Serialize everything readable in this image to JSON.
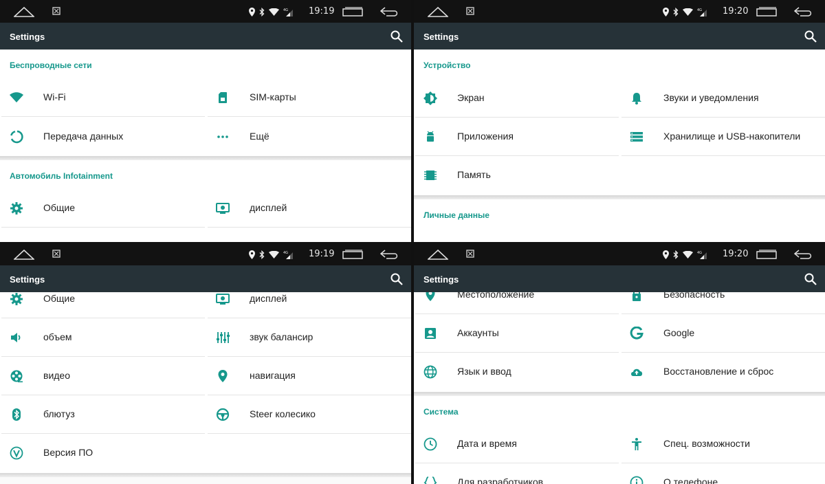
{
  "accent_color": "#16988c",
  "app_bar_color": "#263238",
  "panels": [
    {
      "status_time": "19:19",
      "title": "Settings",
      "sections": [
        {
          "header": "Беспроводные сети",
          "items": [
            {
              "label": "Wi-Fi",
              "icon": "wifi-icon"
            },
            {
              "label": "SIM-карты",
              "icon": "sim-card-icon"
            },
            {
              "label": "Передача данных",
              "icon": "data-usage-icon"
            },
            {
              "label": "Ещё",
              "icon": "more-horiz-icon"
            }
          ]
        },
        {
          "header": "Автомобиль Infotainment",
          "items": [
            {
              "label": "Общие",
              "icon": "gear-icon"
            },
            {
              "label": "дисплей",
              "icon": "display-icon"
            }
          ]
        }
      ]
    },
    {
      "status_time": "19:20",
      "title": "Settings",
      "sections": [
        {
          "header": "Устройство",
          "items": [
            {
              "label": "Экран",
              "icon": "brightness-icon"
            },
            {
              "label": "Звуки и уведомления",
              "icon": "bell-icon"
            },
            {
              "label": "Приложения",
              "icon": "android-icon"
            },
            {
              "label": "Хранилище и USB-накопители",
              "icon": "storage-icon"
            },
            {
              "label": "Память",
              "icon": "memory-chip-icon"
            }
          ]
        },
        {
          "header": "Личные данные",
          "items": []
        }
      ]
    },
    {
      "status_time": "19:19",
      "title": "Settings",
      "sections": [
        {
          "header": "",
          "items": [
            {
              "label": "Общие",
              "icon": "gear-icon"
            },
            {
              "label": "дисплей",
              "icon": "display-icon"
            },
            {
              "label": "объем",
              "icon": "volume-icon"
            },
            {
              "label": "звук балансир",
              "icon": "equalizer-icon"
            },
            {
              "label": "видео",
              "icon": "video-reel-icon"
            },
            {
              "label": "навигация",
              "icon": "location-pin-icon"
            },
            {
              "label": "блютуз",
              "icon": "bluetooth-icon"
            },
            {
              "label": "Steer колесико",
              "icon": "steering-wheel-icon"
            },
            {
              "label": "Версия ПО",
              "icon": "version-icon"
            }
          ]
        }
      ]
    },
    {
      "status_time": "19:20",
      "title": "Settings",
      "sections": [
        {
          "header": "",
          "items": [
            {
              "label": "Местоположение",
              "icon": "location-pin-icon"
            },
            {
              "label": "Безопасность",
              "icon": "lock-icon"
            },
            {
              "label": "Аккаунты",
              "icon": "account-icon"
            },
            {
              "label": "Google",
              "icon": "google-icon"
            },
            {
              "label": "Язык и ввод",
              "icon": "globe-icon"
            },
            {
              "label": "Восстановление и сброс",
              "icon": "cloud-upload-icon"
            }
          ]
        },
        {
          "header": "Система",
          "items": [
            {
              "label": "Дата и время",
              "icon": "clock-icon"
            },
            {
              "label": "Спец. возможности",
              "icon": "accessibility-icon"
            },
            {
              "label": "Для разработчиков",
              "icon": "code-braces-icon"
            },
            {
              "label": "О телефоне",
              "icon": "info-icon"
            }
          ]
        }
      ]
    }
  ]
}
